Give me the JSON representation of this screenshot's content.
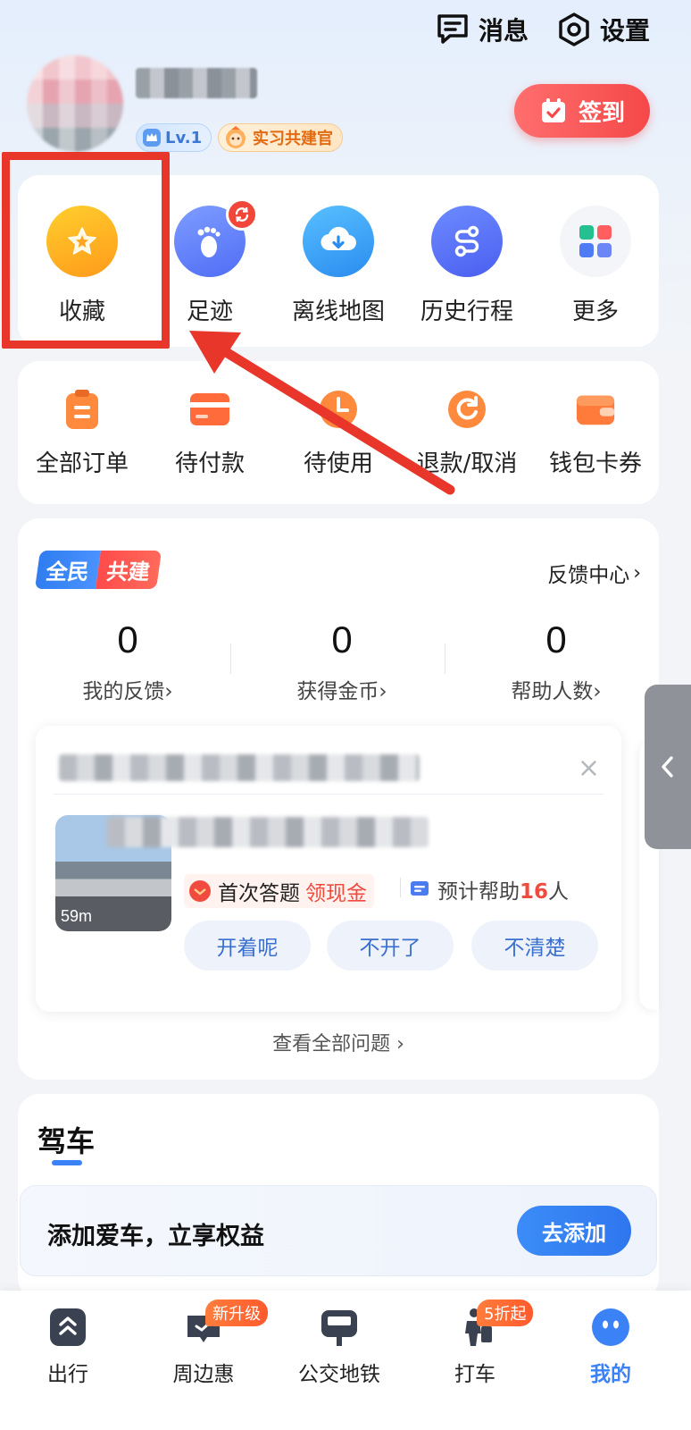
{
  "header": {
    "messages_label": "消息",
    "settings_label": "设置"
  },
  "profile": {
    "level": "Lv.1",
    "role_badge": "实习共建官",
    "checkin_label": "签到"
  },
  "quick_access": [
    {
      "label": "收藏",
      "icon": "star-icon"
    },
    {
      "label": "足迹",
      "icon": "footprint-icon"
    },
    {
      "label": "离线地图",
      "icon": "cloud-download-icon"
    },
    {
      "label": "历史行程",
      "icon": "route-icon"
    },
    {
      "label": "更多",
      "icon": "grid-icon"
    }
  ],
  "orders": [
    {
      "label": "全部订单",
      "icon": "clipboard-icon"
    },
    {
      "label": "待付款",
      "icon": "card-icon"
    },
    {
      "label": "待使用",
      "icon": "clock-icon"
    },
    {
      "label": "退款/取消",
      "icon": "refund-icon"
    },
    {
      "label": "钱包卡券",
      "icon": "wallet-icon"
    }
  ],
  "co_build": {
    "badge_left": "全民",
    "badge_right": "共建",
    "feedback_center": "反馈中心",
    "stats": [
      {
        "value": "0",
        "label": "我的反馈"
      },
      {
        "value": "0",
        "label": "获得金币"
      },
      {
        "value": "0",
        "label": "帮助人数"
      }
    ],
    "question": {
      "distance": "59m",
      "reward_prefix": "首次答题",
      "reward_highlight": "领现金",
      "help_prefix": "预计帮助",
      "help_count": "16",
      "help_suffix": "人",
      "answers": [
        "开着呢",
        "不开了",
        "不清楚"
      ]
    },
    "view_all": "查看全部问题"
  },
  "driving": {
    "title": "驾车",
    "promo_text": "添加爱车，立享权益",
    "add_button": "去添加"
  },
  "tabbar": [
    {
      "label": "出行",
      "icon": "travel-icon",
      "badge": ""
    },
    {
      "label": "周边惠",
      "icon": "nearby-icon",
      "badge": "新升级"
    },
    {
      "label": "公交地铁",
      "icon": "bus-icon",
      "badge": ""
    },
    {
      "label": "打车",
      "icon": "taxi-icon",
      "badge": "5折起"
    },
    {
      "label": "我的",
      "icon": "mine-icon",
      "badge": ""
    }
  ],
  "colors": {
    "accent_blue": "#3b82f6",
    "checkin_red": "#f54848",
    "highlight_box": "#e8362b",
    "promo_orange": "#ff5a2c"
  }
}
